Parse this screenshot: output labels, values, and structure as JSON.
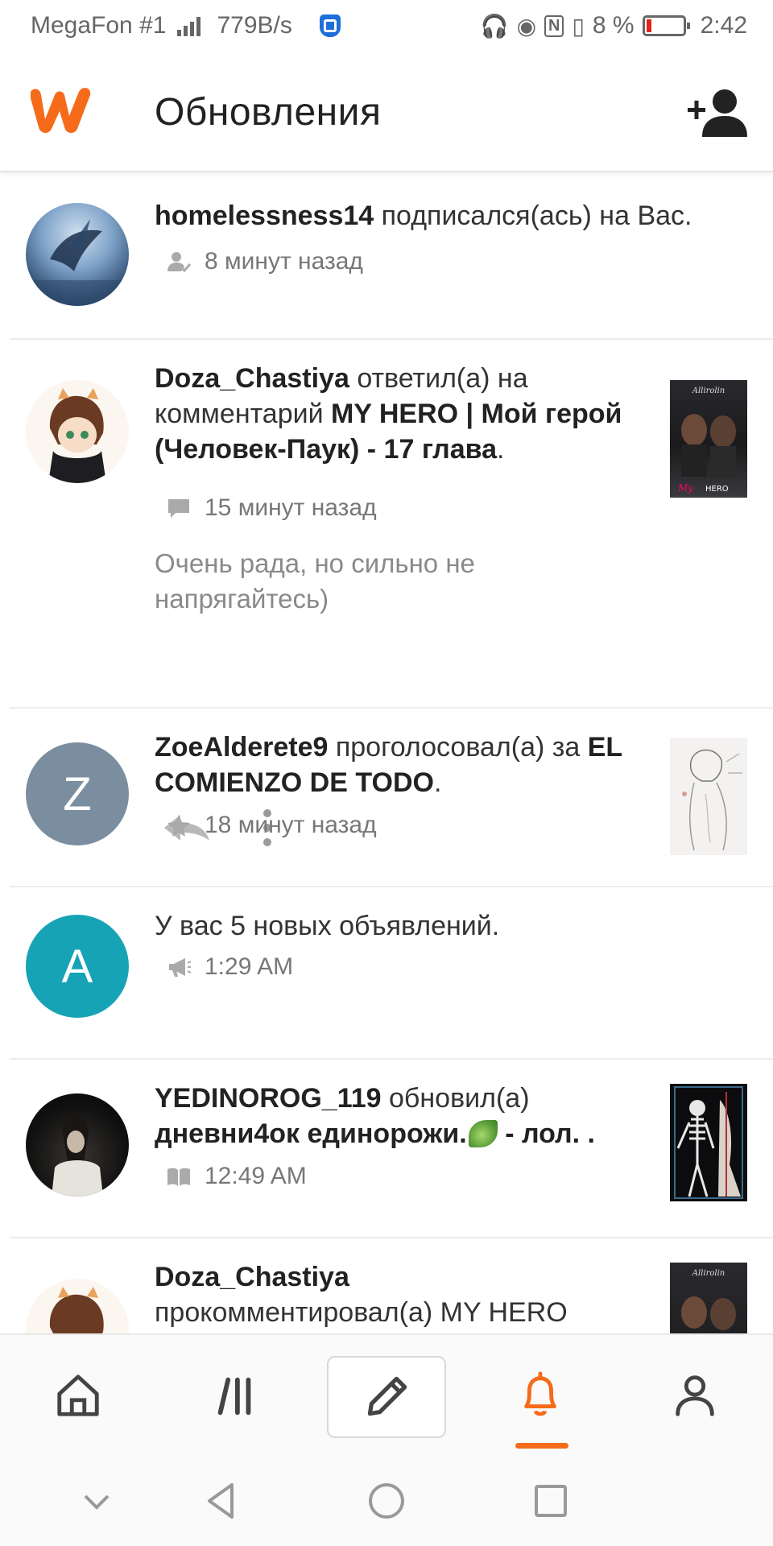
{
  "status_bar": {
    "carrier": "MegaFon #1",
    "net_speed": "779B/s",
    "battery_percent": "8 %",
    "time": "2:42"
  },
  "app_bar": {
    "title": "Обновления",
    "logo_icon": "wattpad-logo",
    "brand_color": "#f56b1a"
  },
  "feed": [
    {
      "user": "homelessness14",
      "action": " подписался(ась) на Вас.",
      "meta_icon": "follow-icon",
      "time": "8 минут назад"
    },
    {
      "user": "Doza_Chastiya",
      "action": " ответил(а) на комментарий ",
      "target": "MY HERO | Мой герой (Человек-Паук) - 17 глава",
      "suffix": ".",
      "meta_icon": "comment-icon",
      "time": "15 минут назад",
      "comment": "Очень рада, но сильно не напрягайтесь)",
      "thumb_title": "Allirolin"
    },
    {
      "user": "ZoeAlderete9",
      "avatar_letter": "Z",
      "avatar_color": "#7a8ea0",
      "action": " проголосовал(а) за ",
      "target": "EL COMIENZO DE TODO",
      "suffix": ".",
      "meta_icon": "star-icon",
      "time": "18 минут назад"
    },
    {
      "avatar_letter": "A",
      "avatar_color": "#16a3b5",
      "text": "У вас 5 новых объявлений.",
      "meta_icon": "megaphone-icon",
      "time": "1:29 AM"
    },
    {
      "user": "YEDINOROG_119",
      "action": " обновил(а) ",
      "target": "дневни4ок единорожи.",
      "target_suffix": " - лол. .",
      "meta_icon": "book-icon",
      "time": "12:49 AM"
    },
    {
      "user": "Doza_Chastiya",
      "second_line": "прокомментировал(а) MY HERO",
      "thumb_title": "Allirolin"
    }
  ],
  "bottom_nav": {
    "items": [
      "home-icon",
      "library-icon",
      "write-icon",
      "notifications-icon",
      "profile-icon"
    ],
    "active": "notifications-icon"
  },
  "system_nav": [
    "collapse-icon",
    "back-icon",
    "home-circle-icon",
    "recents-icon"
  ]
}
